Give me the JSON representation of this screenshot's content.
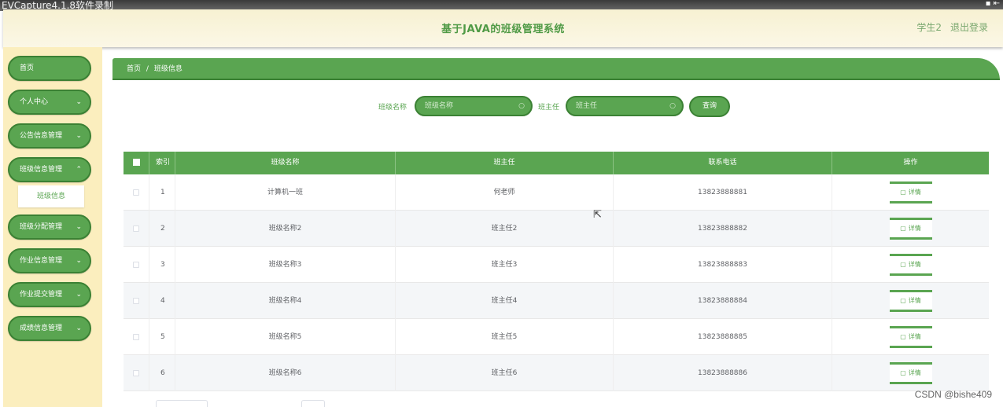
{
  "capture_bar": {
    "title": "EVCapture4.1.8软件录制"
  },
  "header": {
    "title": "基于JAVA的班级管理系统",
    "user": "学生2",
    "logout": "退出登录"
  },
  "sidebar": {
    "items": [
      {
        "label": "首页",
        "has_chevron": false
      },
      {
        "label": "个人中心",
        "has_chevron": true
      },
      {
        "label": "公告信息管理",
        "has_chevron": true
      },
      {
        "label": "班级信息管理",
        "has_chevron": true
      },
      {
        "label": "班级分配管理",
        "has_chevron": true
      },
      {
        "label": "作业信息管理",
        "has_chevron": true
      },
      {
        "label": "作业提交管理",
        "has_chevron": true
      },
      {
        "label": "成绩信息管理",
        "has_chevron": true
      }
    ],
    "active_submenu": "班级信息"
  },
  "breadcrumb": {
    "home": "首页",
    "separator": "/",
    "current": "班级信息"
  },
  "search": {
    "class_name_label": "班级名称",
    "class_name_placeholder": "班级名称",
    "teacher_label": "班主任",
    "teacher_placeholder": "班主任",
    "query_button": "查询"
  },
  "table": {
    "headers": [
      "索引",
      "班级名称",
      "班主任",
      "联系电话",
      "操作"
    ],
    "rows": [
      {
        "index": "1",
        "class_name": "计算机一班",
        "teacher": "何老师",
        "phone": "13823888881"
      },
      {
        "index": "2",
        "class_name": "班级名称2",
        "teacher": "班主任2",
        "phone": "13823888882"
      },
      {
        "index": "3",
        "class_name": "班级名称3",
        "teacher": "班主任3",
        "phone": "13823888883"
      },
      {
        "index": "4",
        "class_name": "班级名称4",
        "teacher": "班主任4",
        "phone": "13823888884"
      },
      {
        "index": "5",
        "class_name": "班级名称5",
        "teacher": "班主任5",
        "phone": "13823888885"
      },
      {
        "index": "6",
        "class_name": "班级名称6",
        "teacher": "班主任6",
        "phone": "13823888886"
      }
    ],
    "detail_label": "详情"
  },
  "watermark": "CSDN @bishe409",
  "colors": {
    "accent": "#5aa551",
    "accent_dark": "#3b8134",
    "sidebar_bg": "#fbeebe",
    "header_bg": "#f7f1d2"
  }
}
